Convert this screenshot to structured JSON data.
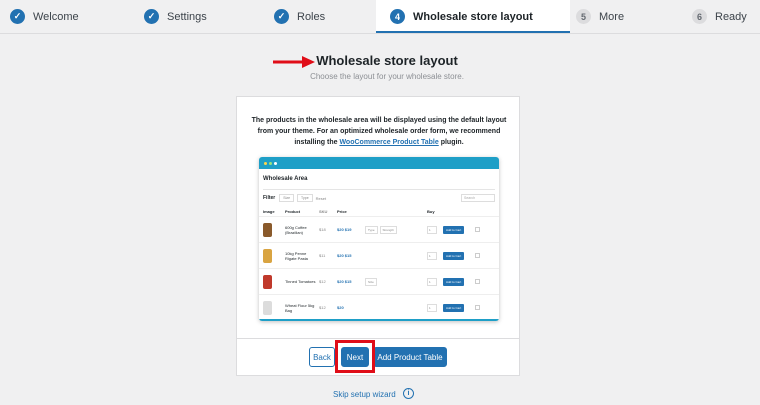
{
  "stepper": {
    "steps": [
      {
        "label": "Welcome",
        "state": "done",
        "marker": "✓"
      },
      {
        "label": "Settings",
        "state": "done",
        "marker": "✓"
      },
      {
        "label": "Roles",
        "state": "done",
        "marker": "✓"
      },
      {
        "label": "Wholesale store layout",
        "state": "active",
        "marker": "4"
      },
      {
        "label": "More",
        "state": "todo",
        "marker": "5"
      },
      {
        "label": "Ready",
        "state": "todo",
        "marker": "6"
      }
    ]
  },
  "header": {
    "title": "Wholesale store layout",
    "subtitle": "Choose the layout for your wholesale store."
  },
  "card": {
    "intro_text": "The products in the wholesale area will be displayed using the default layout from your theme. For an optimized wholesale order form, we recommend installing the ",
    "intro_link": "WooCommerce Product Table",
    "intro_suffix": " plugin.",
    "back_label": "Back",
    "next_label": "Next",
    "table_label": "Add Product Table"
  },
  "preview": {
    "title": "Wholesale Area",
    "filter_label": "Filter",
    "filter_size": "Size",
    "filter_type": "Type",
    "filter_reset": "Reset",
    "search_placeholder": "Search",
    "columns": {
      "image": "Image",
      "product": "Product",
      "sku": "SKU",
      "price": "Price",
      "buy": "Buy"
    },
    "rows": [
      {
        "product": "600g Coffee (Brazilian)",
        "sku": "$18",
        "price": "$20  $19",
        "opt1": "Type",
        "opt2": "Strength",
        "qty": "1",
        "add": "Add to Cart",
        "thumb_color": "#8a5a2b"
      },
      {
        "product": "10kg Penne Rigate Pasta",
        "sku": "$11",
        "price": "$20  $15",
        "opt1": "",
        "opt2": "",
        "qty": "1",
        "add": "Add to Cart",
        "thumb_color": "#d9a441"
      },
      {
        "product": "Tinned Tomatoes",
        "sku": "$12",
        "price": "$20  $15",
        "opt1": "Size",
        "opt2": "",
        "qty": "1",
        "add": "Add to Cart",
        "thumb_color": "#c0392b"
      },
      {
        "product": "Wheat Flour 5kg Bag",
        "sku": "$12",
        "price": "$20",
        "opt1": "",
        "opt2": "",
        "qty": "1",
        "add": "Add to Cart",
        "thumb_color": "#dcdcdc"
      }
    ]
  },
  "footer": {
    "skip_label": "Skip setup wizard",
    "info_icon": "i"
  },
  "colors": {
    "accent": "#2271b1",
    "highlight": "#e00d18"
  }
}
